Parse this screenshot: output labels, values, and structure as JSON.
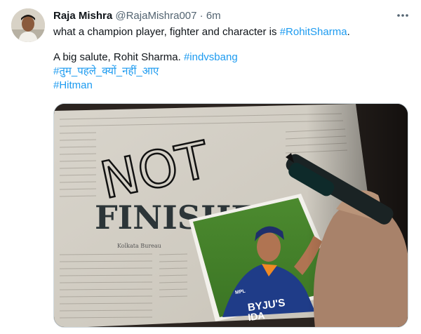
{
  "tweet": {
    "display_name": "Raja Mishra",
    "handle": "@RajaMishra007",
    "separator": "·",
    "timestamp": "6m",
    "text_line_1_prefix": "what a champion player, fighter and character is ",
    "text_line_1_hashtag": "#RohitSharma",
    "text_line_1_suffix": ".",
    "text_line_2_prefix": "A big salute, Rohit Sharma. ",
    "text_line_2_hashtag": "#indvsbang",
    "hashtag_3": "#तुम_पहले_क्यों_नहीं_आए",
    "hashtag_4": "#Hitman",
    "more_icon": "more-dots-icon"
  },
  "media": {
    "handwritten_1": "NOT",
    "handwritten_2": "FINISHED",
    "newspaper_byline": "Kolkata Bureau",
    "jersey_text": "BYJU'S",
    "jersey_text_2": "IDA",
    "jersey_brand": "MPL"
  },
  "colors": {
    "accent": "#1d9bf0",
    "text_primary": "#0f1419",
    "text_secondary": "#536471"
  }
}
